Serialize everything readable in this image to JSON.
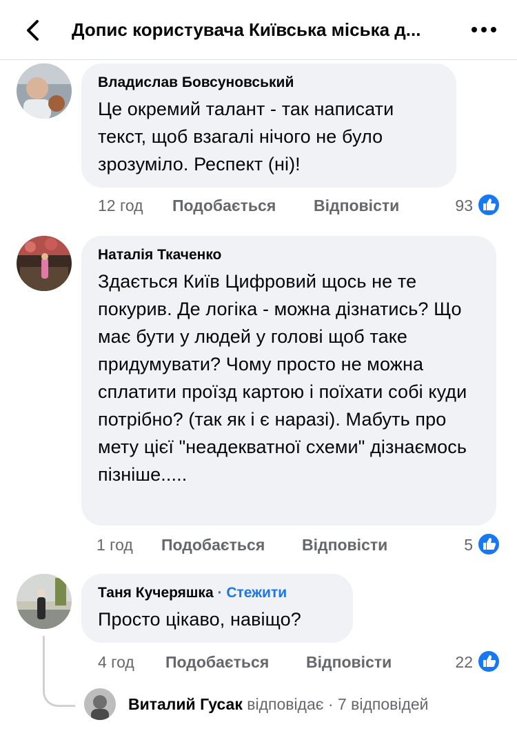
{
  "header": {
    "title": "Допис користувача Київська міська д...",
    "back_icon": "chevron-left-icon",
    "more_icon": "more-dots-icon",
    "more_label": "•••"
  },
  "comments": [
    {
      "author": "Владислав Бовсуновський",
      "text": "Це окремий талант - так написати текст, щоб взагалі нічого не було зрозуміло. Респект (ні)!",
      "time": "12 год",
      "like_label": "Подобається",
      "reply_label": "Відповісти",
      "reactions": "93"
    },
    {
      "author": "Наталія Ткаченко",
      "text": "Здається Київ Цифровий щось не те покурив. Де логіка - можна дізнатись? Що має бути у людей у голові щоб таке придумувати? Чому просто не можна сплатити проїзд картою і поїхати собі куди потрібно? (так як і є наразі).  Мабуть про мету цієї \"неадекватної схеми\" дізнаємось пізніше.....",
      "time": "1 год",
      "like_label": "Подобається",
      "reply_label": "Відповісти",
      "reactions": "5"
    },
    {
      "author": "Таня Кучеряшка",
      "separator": "·",
      "follow_label": "Стежити",
      "text": "Просто цікаво, навіщо?",
      "time": "4 год",
      "like_label": "Подобається",
      "reply_label": "Відповісти",
      "reactions": "22"
    }
  ],
  "reply_summary": {
    "author": "Виталий Гусак",
    "verb": "відповідає",
    "separator": "·",
    "count": "7 відповідей"
  },
  "colors": {
    "accent": "#1877f2",
    "bubble": "#f0f2f5",
    "muted": "#65676b"
  }
}
